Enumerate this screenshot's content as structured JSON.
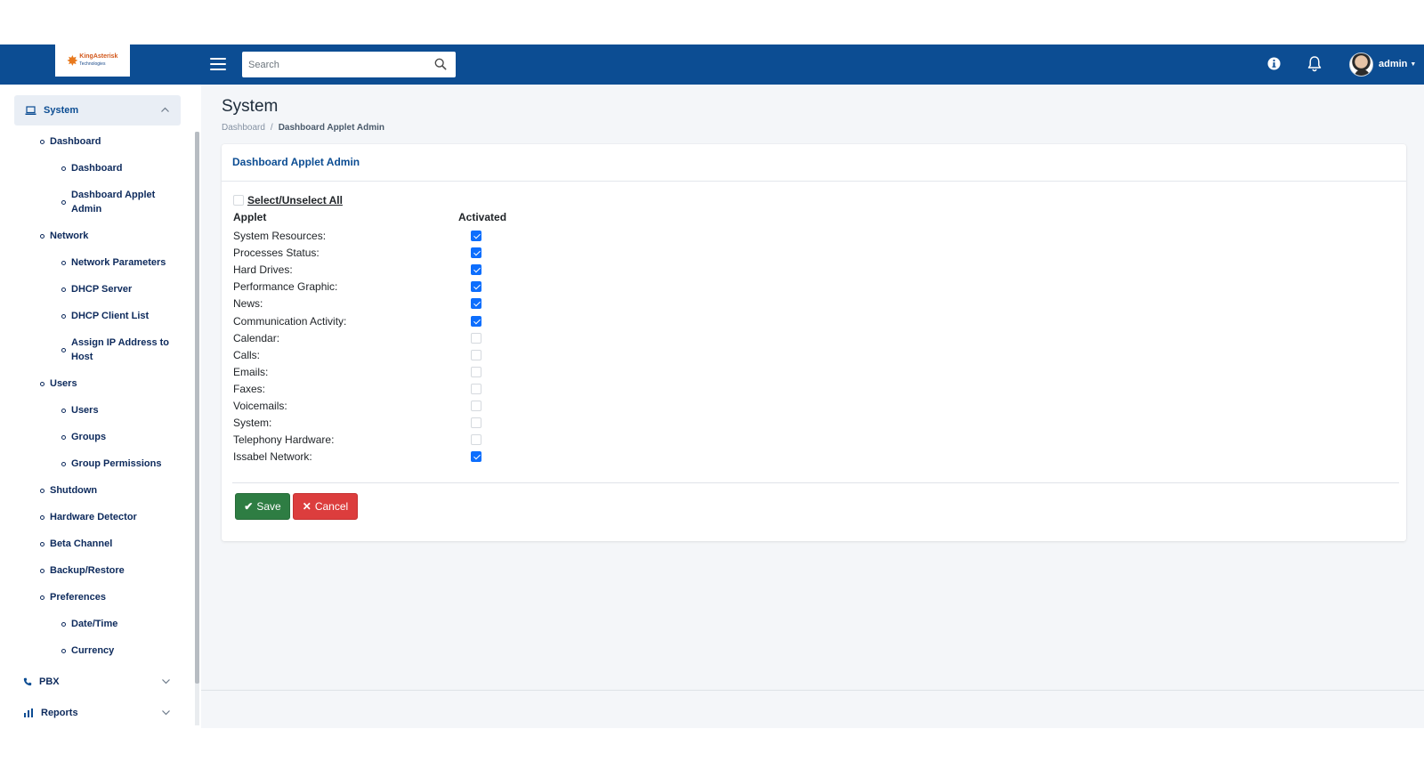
{
  "header": {
    "logo_text": "KingAsterisk",
    "logo_sub": "Technologies",
    "search_placeholder": "Search",
    "user_name": "admin"
  },
  "sidebar": {
    "system": {
      "label": "System",
      "icon": "laptop-icon"
    },
    "groups": [
      {
        "label": "Dashboard",
        "children": [
          "Dashboard",
          "Dashboard Applet Admin"
        ]
      },
      {
        "label": "Network",
        "children": [
          "Network Parameters",
          "DHCP Server",
          "DHCP Client List",
          "Assign IP Address to Host"
        ]
      },
      {
        "label": "Users",
        "children": [
          "Users",
          "Groups",
          "Group Permissions"
        ]
      },
      {
        "label": "Shutdown",
        "children": []
      },
      {
        "label": "Hardware Detector",
        "children": []
      },
      {
        "label": "Beta Channel",
        "children": []
      },
      {
        "label": "Backup/Restore",
        "children": []
      },
      {
        "label": "Preferences",
        "children": [
          "Date/Time",
          "Currency"
        ]
      }
    ],
    "pbx": {
      "label": "PBX",
      "icon": "phone-icon"
    },
    "reports": {
      "label": "Reports",
      "icon": "chart-icon"
    }
  },
  "main": {
    "page_title": "System",
    "breadcrumb": {
      "link": "Dashboard",
      "separator": "/",
      "current": "Dashboard Applet Admin"
    },
    "card_title": "Dashboard Applet Admin",
    "select_all_label": "Select/Unselect All",
    "select_all_checked": false,
    "col_applet": "Applet",
    "col_activated": "Activated",
    "applets": [
      {
        "name": "System Resources:",
        "activated": true
      },
      {
        "name": "Processes Status:",
        "activated": true
      },
      {
        "name": "Hard Drives:",
        "activated": true
      },
      {
        "name": "Performance Graphic:",
        "activated": true
      },
      {
        "name": "News:",
        "activated": true
      },
      {
        "name": "Communication Activity:",
        "activated": true
      },
      {
        "name": "Calendar:",
        "activated": false
      },
      {
        "name": "Calls:",
        "activated": false
      },
      {
        "name": "Emails:",
        "activated": false
      },
      {
        "name": "Faxes:",
        "activated": false
      },
      {
        "name": "Voicemails:",
        "activated": false
      },
      {
        "name": "System:",
        "activated": false
      },
      {
        "name": "Telephony Hardware:",
        "activated": false
      },
      {
        "name": "Issabel Network:",
        "activated": true
      }
    ],
    "save_label": "Save",
    "cancel_label": "Cancel"
  },
  "colors": {
    "header_bg": "#0c4d93",
    "link_blue": "#0c4d93",
    "nav_text": "#0d2a5c",
    "checkbox_checked": "#0d6efd",
    "save_green": "#2e7d43",
    "cancel_red": "#dc3d3d",
    "content_bg": "#f4f6f9"
  }
}
